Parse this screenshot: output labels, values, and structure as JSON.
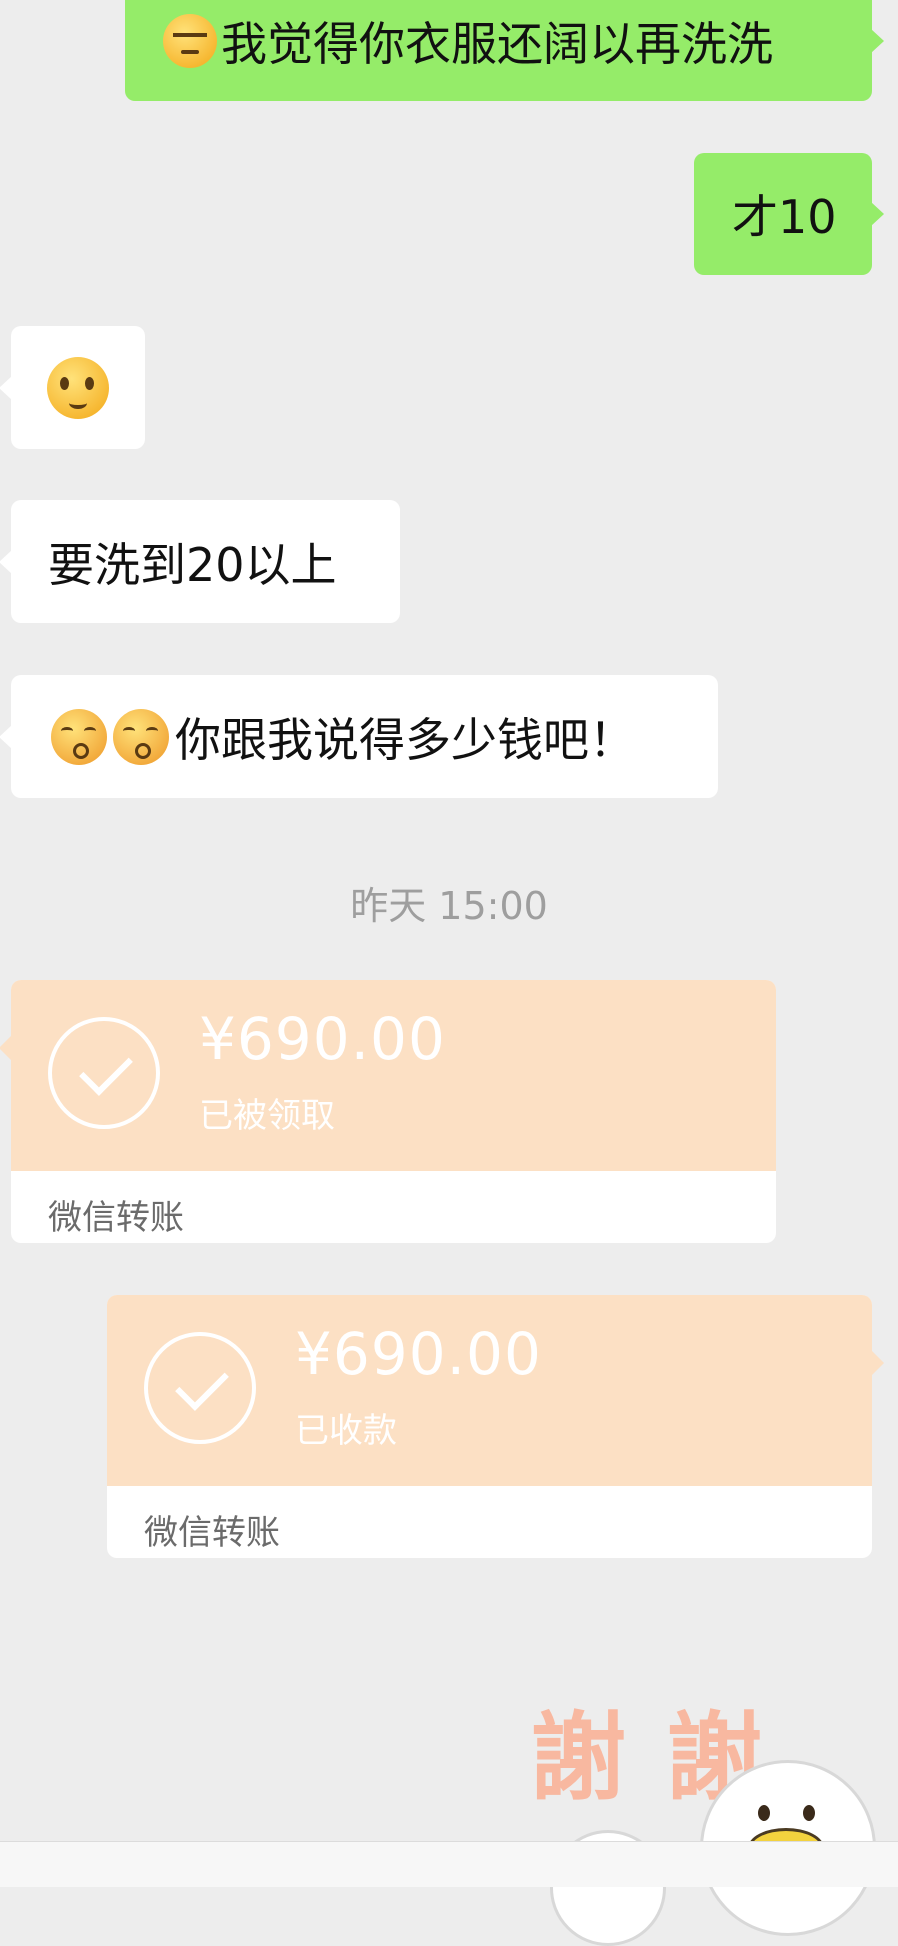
{
  "messages": [
    {
      "side": "out",
      "emoji": "unamused-face",
      "text": "我觉得你衣服还阔以再洗洗"
    },
    {
      "side": "out",
      "text": "才10"
    },
    {
      "side": "in",
      "emoji": "weird-face"
    },
    {
      "side": "in",
      "text": "要洗到20以上"
    },
    {
      "side": "in",
      "emoji": "kissing-face",
      "text": "你跟我说得多少钱吧！"
    }
  ],
  "timestamp": "昨天 15:00",
  "transfers": [
    {
      "side": "in",
      "amount": "¥690.00",
      "status": "已被领取",
      "label": "微信转账"
    },
    {
      "side": "out",
      "amount": "¥690.00",
      "status": "已收款",
      "label": "微信转账"
    }
  ],
  "sticker": {
    "text": "謝謝",
    "icon": "duck-sticker"
  },
  "colors": {
    "background": "#ededed",
    "outgoing_bubble": "#95ec69",
    "incoming_bubble": "#ffffff",
    "transfer_bubble": "#fce0c4",
    "timestamp_text": "#9e9e9e"
  }
}
